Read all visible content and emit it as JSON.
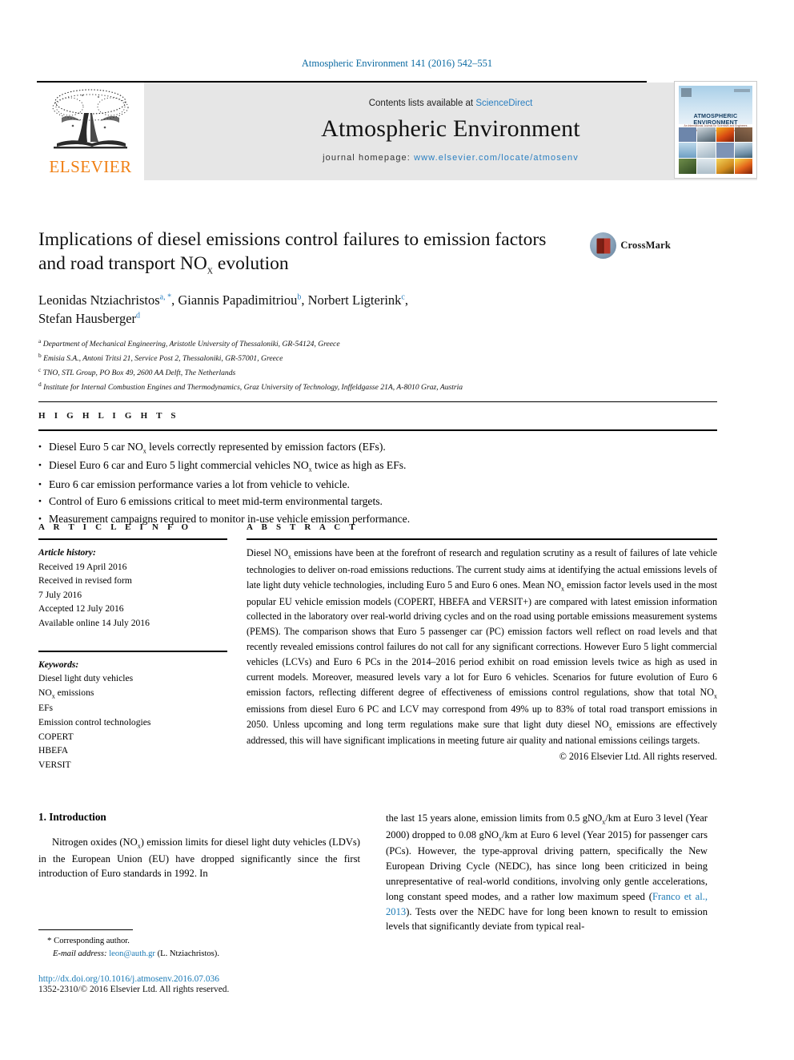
{
  "running_head": "Atmospheric Environment 141 (2016) 542–551",
  "masthead": {
    "contents_prefix": "Contents lists available at ",
    "contents_link": "ScienceDirect",
    "journal_title": "Atmospheric Environment",
    "homepage_prefix": "journal homepage: ",
    "homepage_link": "www.elsevier.com/locate/atmosenv",
    "publisher": "ELSEVIER",
    "cover": {
      "line1": "ATMOSPHERIC",
      "line2": "ENVIRONMENT",
      "subtitle": "An International Journal for Scientists and Engineers\\nof Air Pollution and its Effects on Health and Materials"
    }
  },
  "article": {
    "title_line1": "Implications of diesel emissions control failures to emission factors",
    "title_line2_a": "and road transport NO",
    "title_line2_sub": "X",
    "title_line2_b": " evolution",
    "crossmark_label": "CrossMark",
    "authors": [
      {
        "name": "Leonidas Ntziachristos",
        "marks": "a, *"
      },
      {
        "name": "Giannis Papadimitriou",
        "marks": "b"
      },
      {
        "name": "Norbert Ligterink",
        "marks": "c"
      },
      {
        "name": "Stefan Hausberger",
        "marks": "d"
      }
    ],
    "affiliations": [
      {
        "mark": "a",
        "text": "Department of Mechanical Engineering, Aristotle University of Thessaloniki, GR-54124, Greece"
      },
      {
        "mark": "b",
        "text": "Emisia S.A., Antoni Tritsi 21, Service Post 2, Thessaloniki, GR-57001, Greece"
      },
      {
        "mark": "c",
        "text": "TNO, STL Group, PO Box 49, 2600 AA Delft, The Netherlands"
      },
      {
        "mark": "d",
        "text": "Institute for Internal Combustion Engines and Thermodynamics, Graz University of Technology, Inffeldgasse 21A, A-8010 Graz, Austria"
      }
    ]
  },
  "highlights": {
    "heading": "H I G H L I G H T S",
    "items": [
      "Diesel Euro 5 car NOx levels correctly represented by emission factors (EFs).",
      "Diesel Euro 6 car and Euro 5 light commercial vehicles NOx twice as high as EFs.",
      "Euro 6 car emission performance varies a lot from vehicle to vehicle.",
      "Control of Euro 6 emissions critical to meet mid-term environmental targets.",
      "Measurement campaigns required to monitor in-use vehicle emission performance."
    ]
  },
  "article_info": {
    "heading": "A R T I C L E  I N F O",
    "history_label": "Article history:",
    "history": [
      "Received 19 April 2016",
      "Received in revised form",
      "7 July 2016",
      "Accepted 12 July 2016",
      "Available online 14 July 2016"
    ],
    "keywords_label": "Keywords:",
    "keywords": [
      "Diesel light duty vehicles",
      "NOx emissions",
      "EFs",
      "Emission control technologies",
      "COPERT",
      "HBEFA",
      "VERSIT"
    ]
  },
  "abstract": {
    "heading": "A B S T R A C T",
    "paragraphs": [
      "Diesel NOx emissions have been at the forefront of research and regulation scrutiny as a result of failures of late vehicle technologies to deliver on-road emissions reductions. The current study aims at identifying the actual emissions levels of late light duty vehicle technologies, including Euro 5 and Euro 6 ones. Mean NOx emission factor levels used in the most popular EU vehicle emission models (COPERT, HBEFA and VERSIT+) are compared with latest emission information collected in the laboratory over real-world driving cycles and on the road using portable emissions measurement systems (PEMS). The comparison shows that Euro 5 passenger car (PC) emission factors well reflect on road levels and that recently revealed emissions control failures do not call for any significant corrections. However Euro 5 light commercial vehicles (LCVs) and Euro 6 PCs in the 2014–2016 period exhibit on road emission levels twice as high as used in current models. Moreover, measured levels vary a lot for Euro 6 vehicles. Scenarios for future evolution of Euro 6 emission factors, reflecting different degree of effectiveness of emissions control regulations, show that total NOx emissions from diesel Euro 6 PC and LCV may correspond from 49% up to 83% of total road transport emissions in 2050. Unless upcoming and long term regulations make sure that light duty diesel NOx emissions are effectively addressed, this will have significant implications in meeting future air quality and national emissions ceilings targets."
    ],
    "copyright": "© 2016 Elsevier Ltd. All rights reserved."
  },
  "body": {
    "section_number_title": "1. Introduction",
    "left_paragraph": "Nitrogen oxides (NOx) emission limits for diesel light duty vehicles (LDVs) in the European Union (EU) have dropped significantly since the first introduction of Euro standards in 1992. In",
    "right_paragraph_pre": "the last 15 years alone, emission limits from 0.5 gNOx/km at Euro 3 level (Year 2000) dropped to 0.08 gNOx/km at Euro 6 level (Year 2015) for passenger cars (PCs). However, the type-approval driving pattern, specifically the New European Driving Cycle (NEDC), has since long been criticized in being unrepresentative of real-world conditions, involving only gentle accelerations, long constant speed modes, and a rather low maximum speed (",
    "right_citation": "Franco et al., 2013",
    "right_paragraph_post": "). Tests over the NEDC have for long been known to result to emission levels that significantly deviate from typical real-"
  },
  "footer": {
    "corresponding_star": "*",
    "corresponding_label": "Corresponding author.",
    "email_label": "E-mail address:",
    "email": "leon@auth.gr",
    "email_suffix": "(L. Ntziachristos).",
    "doi": "http://dx.doi.org/10.1016/j.atmosenv.2016.07.036",
    "issn": "1352-2310/© 2016 Elsevier Ltd. All rights reserved."
  },
  "colors": {
    "link": "#1b7ab5",
    "header_blue": "#0b6aa2",
    "elsevier_orange": "#f07f13",
    "banner_bg": "#e6e6e6"
  }
}
